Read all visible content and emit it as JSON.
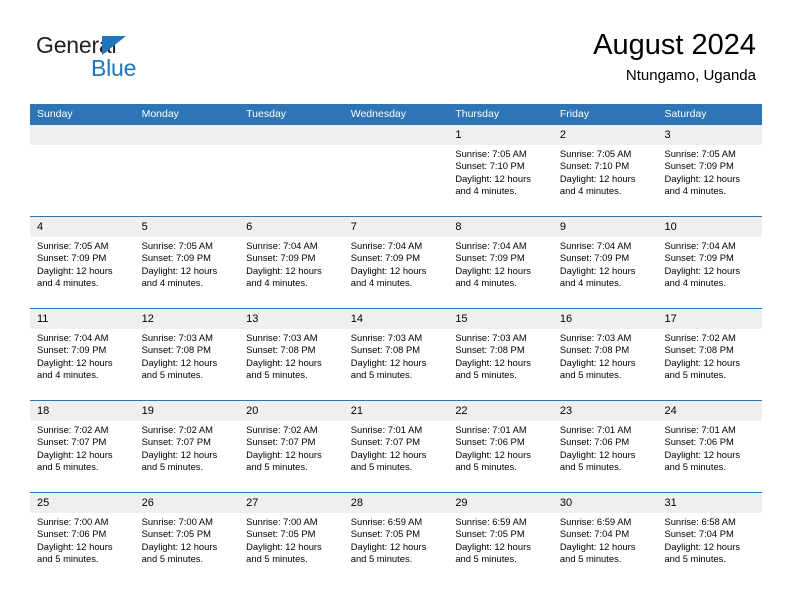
{
  "brand": {
    "name_part1": "General",
    "name_part2": "Blue",
    "accent_color": "#1f76bc"
  },
  "header": {
    "title": "August 2024",
    "subtitle": "Ntungamo, Uganda"
  },
  "theme": {
    "header_blue": "#2e75b6",
    "date_band_gray": "#efefef"
  },
  "day_headers": [
    "Sunday",
    "Monday",
    "Tuesday",
    "Wednesday",
    "Thursday",
    "Friday",
    "Saturday"
  ],
  "weeks": [
    {
      "days": [
        {
          "date": "",
          "lines": []
        },
        {
          "date": "",
          "lines": []
        },
        {
          "date": "",
          "lines": []
        },
        {
          "date": "",
          "lines": []
        },
        {
          "date": "1",
          "lines": [
            "Sunrise: 7:05 AM",
            "Sunset: 7:10 PM",
            "Daylight: 12 hours",
            "and 4 minutes."
          ]
        },
        {
          "date": "2",
          "lines": [
            "Sunrise: 7:05 AM",
            "Sunset: 7:10 PM",
            "Daylight: 12 hours",
            "and 4 minutes."
          ]
        },
        {
          "date": "3",
          "lines": [
            "Sunrise: 7:05 AM",
            "Sunset: 7:09 PM",
            "Daylight: 12 hours",
            "and 4 minutes."
          ]
        }
      ]
    },
    {
      "days": [
        {
          "date": "4",
          "lines": [
            "Sunrise: 7:05 AM",
            "Sunset: 7:09 PM",
            "Daylight: 12 hours",
            "and 4 minutes."
          ]
        },
        {
          "date": "5",
          "lines": [
            "Sunrise: 7:05 AM",
            "Sunset: 7:09 PM",
            "Daylight: 12 hours",
            "and 4 minutes."
          ]
        },
        {
          "date": "6",
          "lines": [
            "Sunrise: 7:04 AM",
            "Sunset: 7:09 PM",
            "Daylight: 12 hours",
            "and 4 minutes."
          ]
        },
        {
          "date": "7",
          "lines": [
            "Sunrise: 7:04 AM",
            "Sunset: 7:09 PM",
            "Daylight: 12 hours",
            "and 4 minutes."
          ]
        },
        {
          "date": "8",
          "lines": [
            "Sunrise: 7:04 AM",
            "Sunset: 7:09 PM",
            "Daylight: 12 hours",
            "and 4 minutes."
          ]
        },
        {
          "date": "9",
          "lines": [
            "Sunrise: 7:04 AM",
            "Sunset: 7:09 PM",
            "Daylight: 12 hours",
            "and 4 minutes."
          ]
        },
        {
          "date": "10",
          "lines": [
            "Sunrise: 7:04 AM",
            "Sunset: 7:09 PM",
            "Daylight: 12 hours",
            "and 4 minutes."
          ]
        }
      ]
    },
    {
      "days": [
        {
          "date": "11",
          "lines": [
            "Sunrise: 7:04 AM",
            "Sunset: 7:09 PM",
            "Daylight: 12 hours",
            "and 4 minutes."
          ]
        },
        {
          "date": "12",
          "lines": [
            "Sunrise: 7:03 AM",
            "Sunset: 7:08 PM",
            "Daylight: 12 hours",
            "and 5 minutes."
          ]
        },
        {
          "date": "13",
          "lines": [
            "Sunrise: 7:03 AM",
            "Sunset: 7:08 PM",
            "Daylight: 12 hours",
            "and 5 minutes."
          ]
        },
        {
          "date": "14",
          "lines": [
            "Sunrise: 7:03 AM",
            "Sunset: 7:08 PM",
            "Daylight: 12 hours",
            "and 5 minutes."
          ]
        },
        {
          "date": "15",
          "lines": [
            "Sunrise: 7:03 AM",
            "Sunset: 7:08 PM",
            "Daylight: 12 hours",
            "and 5 minutes."
          ]
        },
        {
          "date": "16",
          "lines": [
            "Sunrise: 7:03 AM",
            "Sunset: 7:08 PM",
            "Daylight: 12 hours",
            "and 5 minutes."
          ]
        },
        {
          "date": "17",
          "lines": [
            "Sunrise: 7:02 AM",
            "Sunset: 7:08 PM",
            "Daylight: 12 hours",
            "and 5 minutes."
          ]
        }
      ]
    },
    {
      "days": [
        {
          "date": "18",
          "lines": [
            "Sunrise: 7:02 AM",
            "Sunset: 7:07 PM",
            "Daylight: 12 hours",
            "and 5 minutes."
          ]
        },
        {
          "date": "19",
          "lines": [
            "Sunrise: 7:02 AM",
            "Sunset: 7:07 PM",
            "Daylight: 12 hours",
            "and 5 minutes."
          ]
        },
        {
          "date": "20",
          "lines": [
            "Sunrise: 7:02 AM",
            "Sunset: 7:07 PM",
            "Daylight: 12 hours",
            "and 5 minutes."
          ]
        },
        {
          "date": "21",
          "lines": [
            "Sunrise: 7:01 AM",
            "Sunset: 7:07 PM",
            "Daylight: 12 hours",
            "and 5 minutes."
          ]
        },
        {
          "date": "22",
          "lines": [
            "Sunrise: 7:01 AM",
            "Sunset: 7:06 PM",
            "Daylight: 12 hours",
            "and 5 minutes."
          ]
        },
        {
          "date": "23",
          "lines": [
            "Sunrise: 7:01 AM",
            "Sunset: 7:06 PM",
            "Daylight: 12 hours",
            "and 5 minutes."
          ]
        },
        {
          "date": "24",
          "lines": [
            "Sunrise: 7:01 AM",
            "Sunset: 7:06 PM",
            "Daylight: 12 hours",
            "and 5 minutes."
          ]
        }
      ]
    },
    {
      "days": [
        {
          "date": "25",
          "lines": [
            "Sunrise: 7:00 AM",
            "Sunset: 7:06 PM",
            "Daylight: 12 hours",
            "and 5 minutes."
          ]
        },
        {
          "date": "26",
          "lines": [
            "Sunrise: 7:00 AM",
            "Sunset: 7:05 PM",
            "Daylight: 12 hours",
            "and 5 minutes."
          ]
        },
        {
          "date": "27",
          "lines": [
            "Sunrise: 7:00 AM",
            "Sunset: 7:05 PM",
            "Daylight: 12 hours",
            "and 5 minutes."
          ]
        },
        {
          "date": "28",
          "lines": [
            "Sunrise: 6:59 AM",
            "Sunset: 7:05 PM",
            "Daylight: 12 hours",
            "and 5 minutes."
          ]
        },
        {
          "date": "29",
          "lines": [
            "Sunrise: 6:59 AM",
            "Sunset: 7:05 PM",
            "Daylight: 12 hours",
            "and 5 minutes."
          ]
        },
        {
          "date": "30",
          "lines": [
            "Sunrise: 6:59 AM",
            "Sunset: 7:04 PM",
            "Daylight: 12 hours",
            "and 5 minutes."
          ]
        },
        {
          "date": "31",
          "lines": [
            "Sunrise: 6:58 AM",
            "Sunset: 7:04 PM",
            "Daylight: 12 hours",
            "and 5 minutes."
          ]
        }
      ]
    }
  ]
}
